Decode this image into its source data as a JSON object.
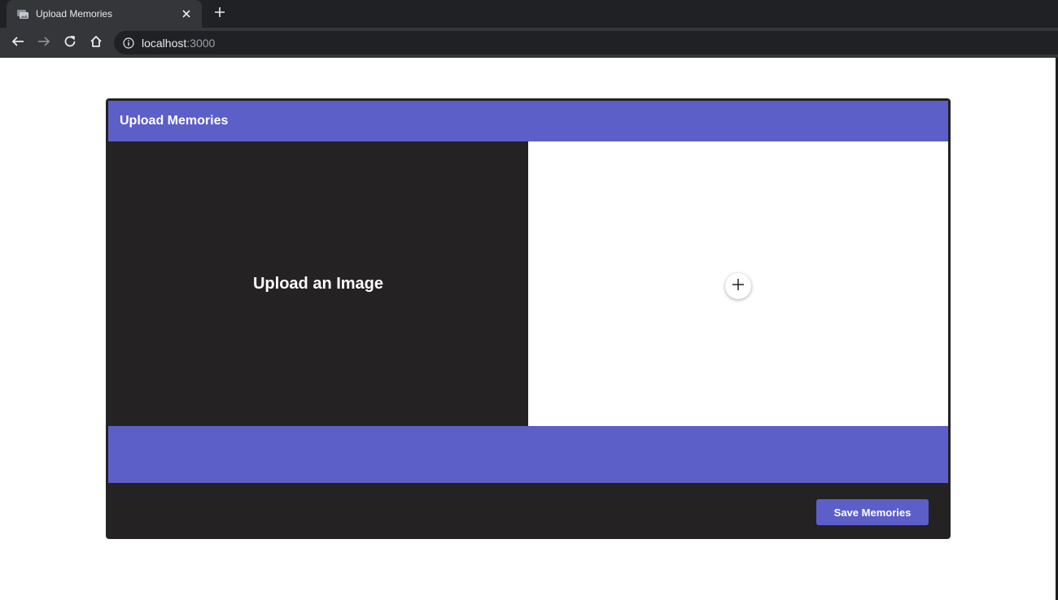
{
  "browser": {
    "tab": {
      "title": "Upload Memories",
      "favicon_icon": "photo-stack-icon",
      "close_label": "✕"
    },
    "new_tab_icon": "plus-icon",
    "nav": {
      "back_icon": "arrow-left-icon",
      "forward_icon": "arrow-right-icon",
      "reload_icon": "reload-icon",
      "home_icon": "home-icon"
    },
    "address": {
      "info_icon": "info-icon",
      "host": "localhost",
      "port": ":3000"
    }
  },
  "card": {
    "title": "Upload Memories",
    "upload_prompt": "Upload an Image",
    "add_button_icon": "plus-icon",
    "save_label": "Save Memories"
  },
  "colors": {
    "accent": "#5c5fc8",
    "panel_dark": "#242222",
    "panel_light": "#ffffff",
    "chrome_dark": "#202124",
    "chrome_mid": "#35363a"
  }
}
